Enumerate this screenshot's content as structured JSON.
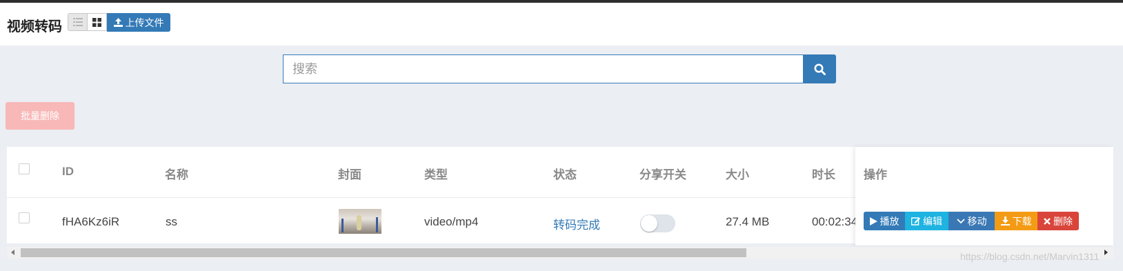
{
  "header": {
    "title": "视频转码",
    "upload_label": "上传文件",
    "view_modes": [
      "list-view-icon",
      "grid-view-icon"
    ]
  },
  "search": {
    "placeholder": "搜索",
    "value": ""
  },
  "actions": {
    "batch_delete_label": "批量删除"
  },
  "table": {
    "columns": [
      "ID",
      "名称",
      "封面",
      "类型",
      "状态",
      "分享开关",
      "大小",
      "时长",
      "操作"
    ],
    "rows": [
      {
        "id": "fHA6Kz6iR",
        "name": "ss",
        "type": "video/mp4",
        "status": "转码完成",
        "share_enabled": false,
        "size": "27.4 MB",
        "duration": "00:02:34"
      }
    ]
  },
  "row_actions": {
    "play": "播放",
    "edit": "编辑",
    "move": "移动",
    "download": "下载",
    "delete": "删除"
  },
  "colors": {
    "primary": "#337ab7",
    "info": "#1eb3e0",
    "warning": "#f49b16",
    "danger": "#d9453a",
    "danger_disabled": "#f8b8b8",
    "background": "#ebeef3"
  },
  "watermark": "https://blog.csdn.net/Marvin1311"
}
